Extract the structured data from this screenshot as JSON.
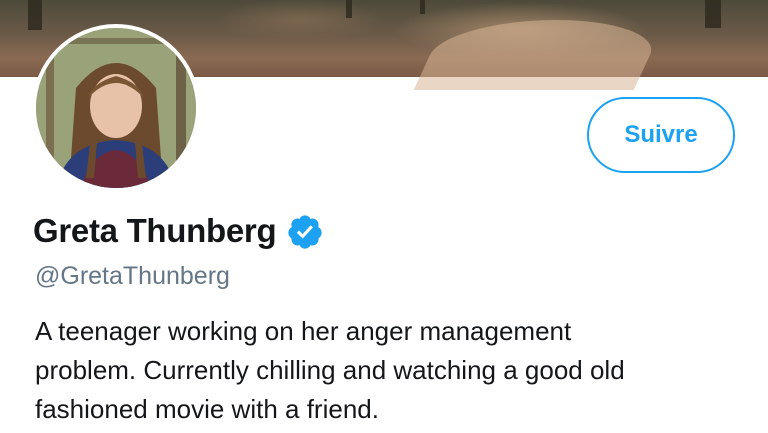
{
  "profile": {
    "display_name": "Greta Thunberg",
    "handle": "@GretaThunberg",
    "verified_icon": "verified-badge-icon",
    "bio": "A teenager working on her anger management\nproblem. Currently chilling and watching a good old\nfashioned movie with a friend.",
    "follow_label": "Suivre"
  },
  "colors": {
    "accent": "#1da1f2",
    "name": "#14171a",
    "handle": "#657786"
  }
}
